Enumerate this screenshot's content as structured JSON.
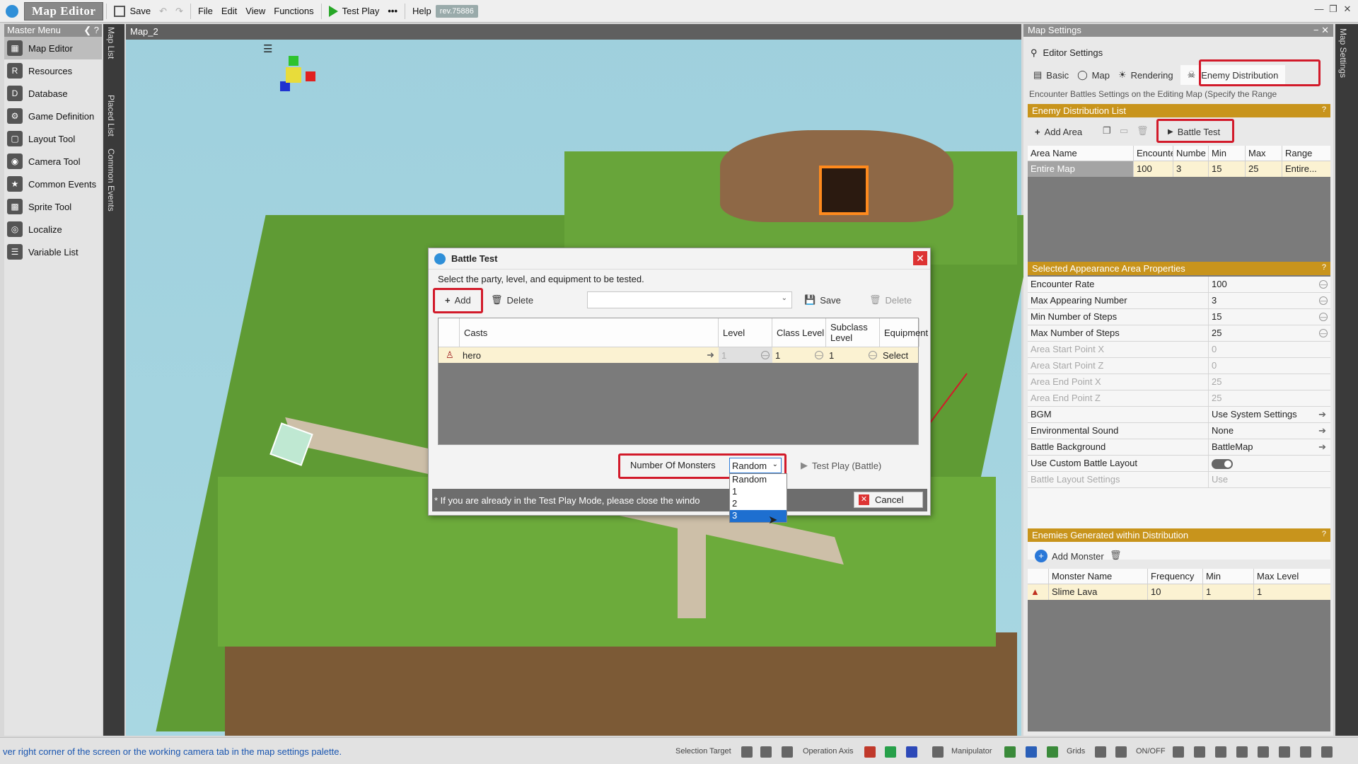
{
  "toolbar": {
    "app_title": "Map Editor",
    "save": "Save",
    "menus": [
      "File",
      "Edit",
      "View",
      "Functions"
    ],
    "test_play": "Test Play",
    "more": "•••",
    "help": "Help",
    "revision": "rev.75886"
  },
  "master_menu": {
    "title": "Master Menu",
    "items": [
      "Map Editor",
      "Resources",
      "Database",
      "Game Definition",
      "Layout Tool",
      "Camera Tool",
      "Common Events",
      "Sprite Tool",
      "Localize",
      "Variable List"
    ]
  },
  "side_tabs": [
    "Map List",
    "Placed List",
    "Common Events"
  ],
  "map_tab": "Map_2",
  "dialog": {
    "title": "Battle Test",
    "instruction": "Select the party, level, and equipment to be tested.",
    "add": "Add",
    "delete": "Delete",
    "save": "Save",
    "delete2": "Delete",
    "columns": [
      "Casts",
      "Level",
      "Class Level",
      "Subclass Level",
      "Equipment"
    ],
    "row": {
      "cast": "hero",
      "level": "1",
      "class_level": "1",
      "subclass_level": "1",
      "equipment": "Select"
    },
    "monsters_label": "Number Of Monsters",
    "monsters_value": "Random",
    "options": [
      "Random",
      "1",
      "2",
      "3"
    ],
    "test_play_battle": "Test Play (Battle)",
    "note": "* If you are already in the Test Play Mode, please close the windo",
    "cancel": "Cancel"
  },
  "map_settings": {
    "title": "Map Settings",
    "editor_settings": "Editor Settings",
    "tabs": [
      "Basic",
      "Map",
      "Rendering",
      "Enemy Distribution"
    ],
    "description": "Encounter Battles Settings on the Editing Map (Specify the Range",
    "enemy_list_header": "Enemy Distribution List",
    "add_area": "Add Area",
    "battle_test": "Battle Test",
    "area_columns": [
      "Area Name",
      "Encounte",
      "Numbe",
      "Min",
      "Max",
      "Range"
    ],
    "area_row": [
      "Entire Map",
      "100",
      "3",
      "15",
      "25",
      "Entire..."
    ],
    "props_header": "Selected Appearance Area Properties",
    "props": [
      {
        "k": "Encounter Rate",
        "v": "100"
      },
      {
        "k": "Max Appearing Number",
        "v": "3"
      },
      {
        "k": "Min Number of Steps",
        "v": "15"
      },
      {
        "k": "Max Number of Steps",
        "v": "25"
      },
      {
        "k": "Area Start Point X",
        "v": "0"
      },
      {
        "k": "Area Start Point Z",
        "v": "0"
      },
      {
        "k": "Area End Point X",
        "v": "25"
      },
      {
        "k": "Area End Point Z",
        "v": "25"
      },
      {
        "k": "BGM",
        "v": "Use System Settings"
      },
      {
        "k": "Environmental Sound",
        "v": "None"
      },
      {
        "k": "Battle Background",
        "v": "BattleMap"
      },
      {
        "k": "Use Custom Battle Layout",
        "v": ""
      },
      {
        "k": "Battle Layout Settings",
        "v": "Use"
      }
    ],
    "enemies_header": "Enemies Generated within Distribution",
    "add_monster": "Add Monster",
    "monster_columns": [
      "Monster Name",
      "Frequency",
      "Min",
      "Max Level"
    ],
    "monster_row": [
      "Slime Lava",
      "10",
      "1",
      "1"
    ]
  },
  "right_tab": "Map Settings",
  "status": {
    "message": "ver right corner of the screen or the working camera tab in the map settings palette.",
    "selection_target": "Selection Target",
    "operation_axis": "Operation Axis",
    "manipulator": "Manipulator",
    "grids": "Grids",
    "onoff": "ON/OFF"
  },
  "colors": {
    "accent": "#c8941c",
    "highlight": "#d21a2a",
    "selection": "#1e6fd0"
  }
}
